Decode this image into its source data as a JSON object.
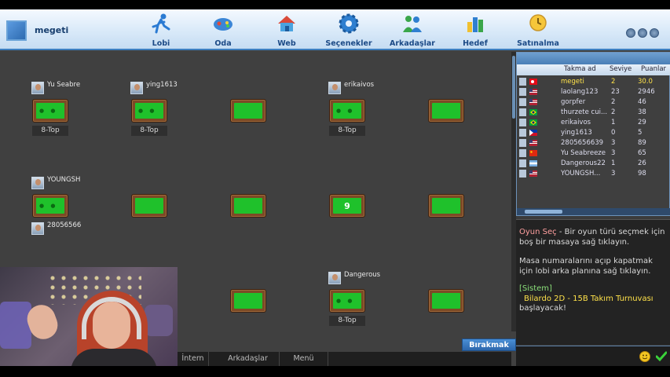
{
  "header": {
    "username": "megeti",
    "nav": [
      {
        "label": "Lobi",
        "icon": "running-man-icon"
      },
      {
        "label": "Oda",
        "icon": "game-controller-icon"
      },
      {
        "label": "Web",
        "icon": "house-icon"
      },
      {
        "label": "Seçenekler",
        "icon": "gear-icon"
      },
      {
        "label": "Arkadaşlar",
        "icon": "friends-icon"
      },
      {
        "label": "Hedef",
        "icon": "bar-chart-icon"
      },
      {
        "label": "Satınalma",
        "icon": "clock-cart-icon"
      }
    ]
  },
  "lobby": {
    "players": {
      "p1": "Yu Seabre",
      "p2": "ying1613",
      "p3": "erikaivos",
      "p4": "YOUNGSH",
      "p5": "28056566",
      "p6": "Dangerous"
    },
    "game_type": "8-Top",
    "table_number": "9",
    "leave_button": "Bırakmak"
  },
  "player_list": {
    "headers": {
      "nick": "Takma ad",
      "level": "Seviye",
      "points": "Puanlar"
    },
    "rows": [
      {
        "name": "megeti",
        "level": "2",
        "points": "30.0",
        "flag": "tr",
        "highlight": true
      },
      {
        "name": "laolang123",
        "level": "23",
        "points": "2946",
        "flag": "us"
      },
      {
        "name": "gorpfer",
        "level": "2",
        "points": "46",
        "flag": "us"
      },
      {
        "name": "thurzete cui...",
        "level": "2",
        "points": "38",
        "flag": "br"
      },
      {
        "name": "erikaivos",
        "level": "1",
        "points": "29",
        "flag": "br"
      },
      {
        "name": "ying1613",
        "level": "0",
        "points": "5",
        "flag": "ph"
      },
      {
        "name": "2805656639",
        "level": "3",
        "points": "89",
        "flag": "us"
      },
      {
        "name": "Yu Seabreeze",
        "level": "3",
        "points": "65",
        "flag": "cn"
      },
      {
        "name": "Dangerous22",
        "level": "1",
        "points": "26",
        "flag": "ar"
      },
      {
        "name": "YOUNGSH...",
        "level": "3",
        "points": "98",
        "flag": "us"
      }
    ]
  },
  "chat": {
    "select_title": "Oyun Seç",
    "select_text": " - Bir oyun türü seçmek için boş bir masaya sağ tıklayın.",
    "table_hint": "Masa numaralarını açıp kapatmak için lobi arka planına sağ tıklayın.",
    "system_label": "[Sistem]",
    "system_msg": "Bilardo 2D - 15B Takım Turnuvası",
    "system_msg_end": "başlayacak!"
  },
  "bottom_tabs": [
    "İntern",
    "Arkadaşlar",
    "Menü"
  ],
  "colors": {
    "accent": "#3d7fc0",
    "felt": "#1fc12b",
    "background": "#404040"
  }
}
